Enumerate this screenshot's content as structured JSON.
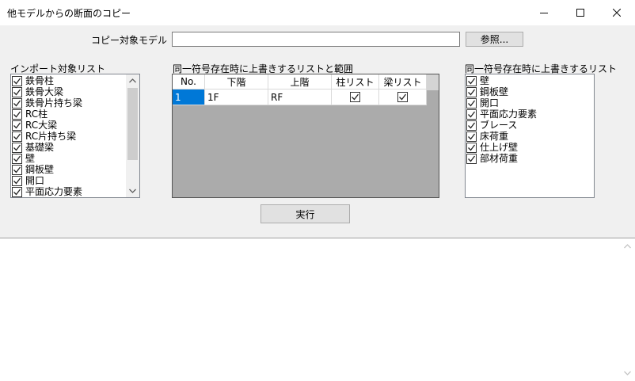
{
  "window": {
    "title": "他モデルからの断面のコピー"
  },
  "copy_model": {
    "label": "コピー対象モデル",
    "value": "",
    "browse_label": "参照..."
  },
  "import_list": {
    "label": "インポート対象リスト",
    "items": [
      {
        "label": "鉄骨柱",
        "checked": true
      },
      {
        "label": "鉄骨大梁",
        "checked": true
      },
      {
        "label": "鉄骨片持ち梁",
        "checked": true
      },
      {
        "label": "RC柱",
        "checked": true
      },
      {
        "label": "RC大梁",
        "checked": true
      },
      {
        "label": "RC片持ち梁",
        "checked": true
      },
      {
        "label": "基礎梁",
        "checked": true
      },
      {
        "label": "壁",
        "checked": true
      },
      {
        "label": "鋼板壁",
        "checked": true
      },
      {
        "label": "開口",
        "checked": true
      },
      {
        "label": "平面応力要素",
        "checked": true
      }
    ]
  },
  "overwrite_range": {
    "label": "同一符号存在時に上書きするリストと範囲",
    "columns": [
      "No.",
      "下階",
      "上階",
      "柱リスト",
      "梁リスト"
    ],
    "rows": [
      {
        "no": "1",
        "lower": "1F",
        "upper": "RF",
        "column_list": true,
        "beam_list": true
      }
    ]
  },
  "overwrite_list": {
    "label": "同一符号存在時に上書きするリスト",
    "items": [
      {
        "label": "壁",
        "checked": true
      },
      {
        "label": "鋼板壁",
        "checked": true
      },
      {
        "label": "開口",
        "checked": true
      },
      {
        "label": "平面応力要素",
        "checked": true
      },
      {
        "label": "ブレース",
        "checked": true
      },
      {
        "label": "床荷重",
        "checked": true
      },
      {
        "label": "仕上げ壁",
        "checked": true
      },
      {
        "label": "部材荷重",
        "checked": true
      }
    ]
  },
  "run_label": "実行"
}
